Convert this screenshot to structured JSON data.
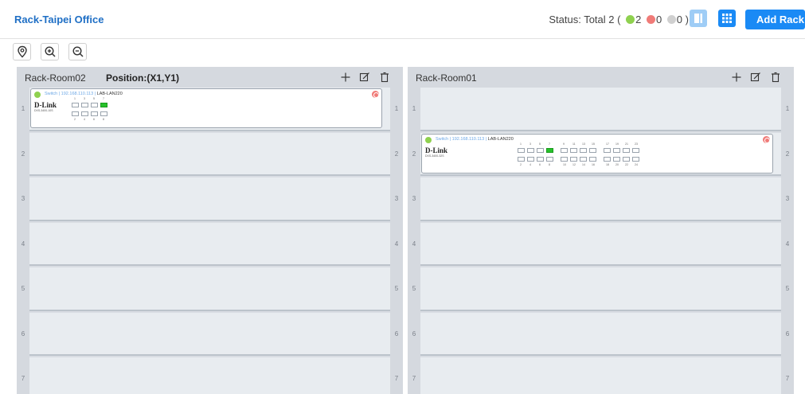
{
  "header": {
    "title": "Rack-Taipei Office",
    "status_prefix": "Status: Total 2 (",
    "status_green": "2",
    "status_red": "0",
    "status_gray": "0",
    "status_suffix": ")",
    "add_rack_label": "Add Rack"
  },
  "colors": {
    "accent": "#1a8af5",
    "title": "#1f6fc5",
    "status_green": "#8fd14f",
    "status_red": "#f07b78",
    "status_gray": "#d0d0d0",
    "port_active": "#27c22b"
  },
  "toolbar": {
    "icons": [
      "location-pin-icon",
      "zoom-in-icon",
      "zoom-out-icon"
    ]
  },
  "racks": [
    {
      "name": "Rack-Room02",
      "position_label": "Position:(X1,Y1)",
      "units": [
        "1",
        "2",
        "3",
        "4",
        "5",
        "6",
        "7"
      ],
      "device": {
        "unit": "1",
        "type_label": "Switch",
        "ip": "192.168.110.113",
        "name": "LAB-LAN220",
        "brand": "D-Link",
        "model": "DXS-3400-10S",
        "port_top_numbers": [
          "1",
          "3",
          "5",
          "7"
        ],
        "port_bottom_numbers": [
          "2",
          "4",
          "6",
          "8"
        ],
        "active_port": "7"
      }
    },
    {
      "name": "Rack-Room01",
      "position_label": "",
      "units": [
        "1",
        "2",
        "3",
        "4",
        "5",
        "6",
        "7"
      ],
      "device": {
        "unit": "2",
        "type_label": "Switch",
        "ip": "192.168.110.113",
        "name": "LAB-LAN220",
        "brand": "D-Link",
        "model": "DXS-3400-32S",
        "port_top_numbers": [
          "1",
          "3",
          "5",
          "7",
          "9",
          "11",
          "13",
          "15",
          "17",
          "19",
          "21",
          "23"
        ],
        "port_bottom_numbers": [
          "2",
          "4",
          "6",
          "8",
          "10",
          "12",
          "14",
          "16",
          "18",
          "20",
          "22",
          "24"
        ],
        "active_port": "7"
      }
    }
  ]
}
